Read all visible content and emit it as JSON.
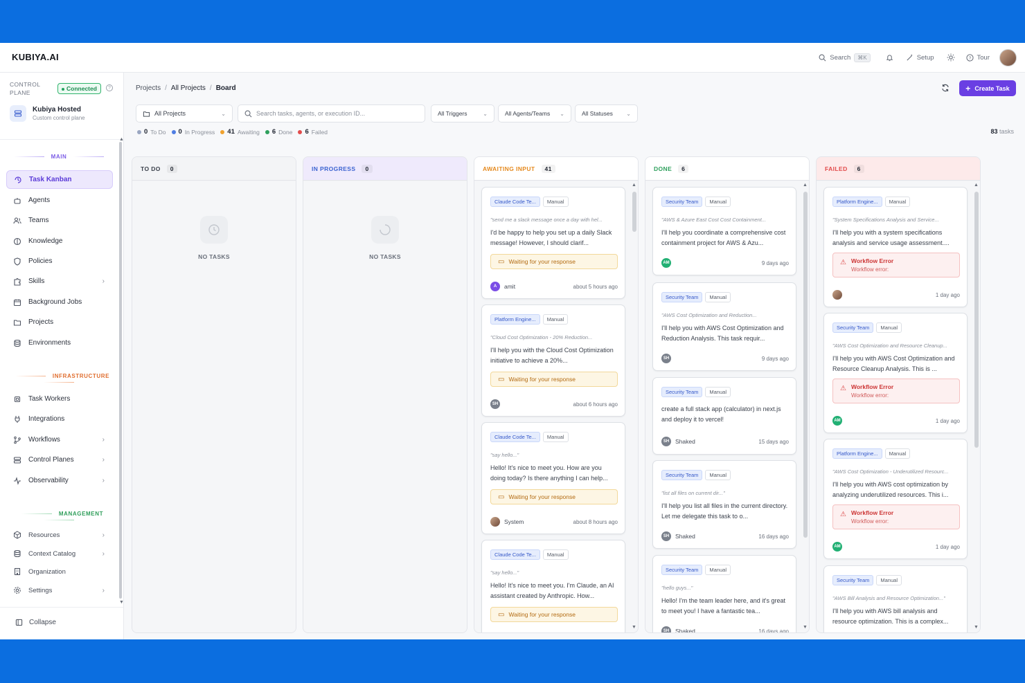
{
  "app": {
    "logo": "KUBIYA.AI"
  },
  "topbar": {
    "search": "Search",
    "kbd": "⌘K",
    "setup": "Setup",
    "tour": "Tour"
  },
  "sidebar": {
    "control_plane": "CONTROL\nPLANE",
    "control_plane_l1": "CONTROL",
    "control_plane_l2": "PLANE",
    "status": "Connected",
    "host_name": "Kubiya Hosted",
    "host_sub": "Custom control plane",
    "sections": {
      "main": "MAIN",
      "infra": "INFRASTRUCTURE",
      "mgmt": "MANAGEMENT"
    },
    "main_items": [
      "Task Kanban",
      "Agents",
      "Teams",
      "Knowledge",
      "Policies",
      "Skills",
      "Background Jobs",
      "Projects",
      "Environments"
    ],
    "infra_items": [
      "Task Workers",
      "Integrations",
      "Workflows",
      "Control Planes",
      "Observability"
    ],
    "mgmt_items": [
      "Resources",
      "Context Catalog",
      "Organization",
      "Settings"
    ],
    "collapse": "Collapse"
  },
  "breadcrumb": {
    "a": "Projects",
    "b": "All Projects",
    "c": "Board"
  },
  "create_task": "Create Task",
  "filters": {
    "project": "All Projects",
    "search_placeholder": "Search tasks, agents, or execution ID...",
    "triggers": "All Triggers",
    "agents": "All Agents/Teams",
    "statuses": "All Statuses"
  },
  "legend": {
    "todo_n": "0",
    "todo": "To Do",
    "prog_n": "0",
    "prog": "In Progress",
    "await_n": "41",
    "await": "Awaiting",
    "done_n": "6",
    "done": "Done",
    "failed_n": "6",
    "failed": "Failed"
  },
  "task_count": {
    "n": "83",
    "label": "tasks"
  },
  "columns": {
    "todo": {
      "title": "TO DO",
      "count": "0",
      "empty": "NO TASKS"
    },
    "prog": {
      "title": "IN PROGRESS",
      "count": "0",
      "empty": "NO TASKS"
    },
    "await": {
      "title": "AWAITING INPUT",
      "count": "41"
    },
    "done": {
      "title": "DONE",
      "count": "6"
    },
    "fail": {
      "title": "FAILED",
      "count": "6"
    }
  },
  "colors": {
    "accent": "#6a3fe3",
    "await": "#e58a1f",
    "done": "#2ea05c",
    "failed": "#e24b4b",
    "progress": "#3d64d1"
  },
  "manual": "Manual",
  "waiting": "Waiting for your response",
  "await_cards": [
    {
      "team": "Claude Code Te...",
      "prompt": "\"send me a slack message once a day with hel...",
      "body": "I'd be happy to help you set up a daily Slack message! However, I should clarif...",
      "user": "amit",
      "avatar": "A",
      "time": "about 5 hours ago"
    },
    {
      "team": "Platform Engine...",
      "prompt": "\"Cloud Cost Optimization - 20% Reduction...",
      "body": "I'll help you with the Cloud Cost Optimization initiative to achieve a 20%...",
      "user": "",
      "avatar": "SH",
      "time": "about 6 hours ago"
    },
    {
      "team": "Claude Code Te...",
      "prompt": "\"say hello...\"",
      "body": "Hello! It's nice to meet you. How are you doing today? Is there anything I can help...",
      "user": "System",
      "avatar": "",
      "time": "about 8 hours ago"
    },
    {
      "team": "Claude Code Te...",
      "prompt": "\"say hello...\"",
      "body": "Hello! It's nice to meet you. I'm Claude, an AI assistant created by Anthropic. How...",
      "user": "",
      "avatar": "",
      "time": ""
    }
  ],
  "done_cards": [
    {
      "team": "Security Team",
      "prompt": "\"AWS & Azure East Cost Cost Containment...",
      "body": "I'll help you coordinate a comprehensive cost containment project for AWS & Azu...",
      "user": "",
      "avatar": "AM",
      "time": "9 days ago"
    },
    {
      "team": "Security Team",
      "prompt": "\"AWS Cost Optimization and Reduction...",
      "body": "I'll help you with AWS Cost Optimization and Reduction Analysis. This task requir...",
      "user": "",
      "avatar": "SH",
      "time": "9 days ago"
    },
    {
      "team": "Security Team",
      "prompt": "",
      "body": "create a full stack app (calculator) in next.js and deploy it to vercel!",
      "user": "Shaked",
      "avatar": "SH",
      "time": "15 days ago"
    },
    {
      "team": "Security Team",
      "prompt": "\"list all files on current dir...\"",
      "body": "I'll help you list all files in the current directory. Let me delegate this task to o...",
      "user": "Shaked",
      "avatar": "SH",
      "time": "16 days ago"
    },
    {
      "team": "Security Team",
      "prompt": "\"hello guys...\"",
      "body": "Hello! I'm the team leader here, and it's great to meet you! I have a fantastic tea...",
      "user": "Shaked",
      "avatar": "SH",
      "time": "16 days ago"
    }
  ],
  "fail_cards": [
    {
      "team": "Platform Engine...",
      "prompt": "\"System Specifications Analysis and Service...",
      "body": "I'll help you with a system specifications analysis and service usage assessment....",
      "err_t": "Workflow Error",
      "err_s": "Workflow error:",
      "avatar": "",
      "time": "1 day ago"
    },
    {
      "team": "Security Team",
      "prompt": "\"AWS Cost Optimization and Resource Cleanup...",
      "body": "I'll help you with AWS Cost Optimization and Resource Cleanup Analysis. This is ...",
      "err_t": "Workflow Error",
      "err_s": "Workflow error:",
      "avatar": "AM",
      "time": "1 day ago"
    },
    {
      "team": "Platform Engine...",
      "prompt": "\"AWS Cost Optimization - Underutilized Resourc...",
      "body": "I'll help you with AWS cost optimization by analyzing underutilized resources. This i...",
      "err_t": "Workflow Error",
      "err_s": "Workflow error:",
      "avatar": "AM",
      "time": "1 day ago"
    },
    {
      "team": "Security Team",
      "prompt": "\"AWS Bill Analysis and Resource Optimization...\"",
      "body": "I'll help you with AWS bill analysis and resource optimization. This is a complex...",
      "err_t": "",
      "err_s": "",
      "avatar": "",
      "time": ""
    }
  ]
}
